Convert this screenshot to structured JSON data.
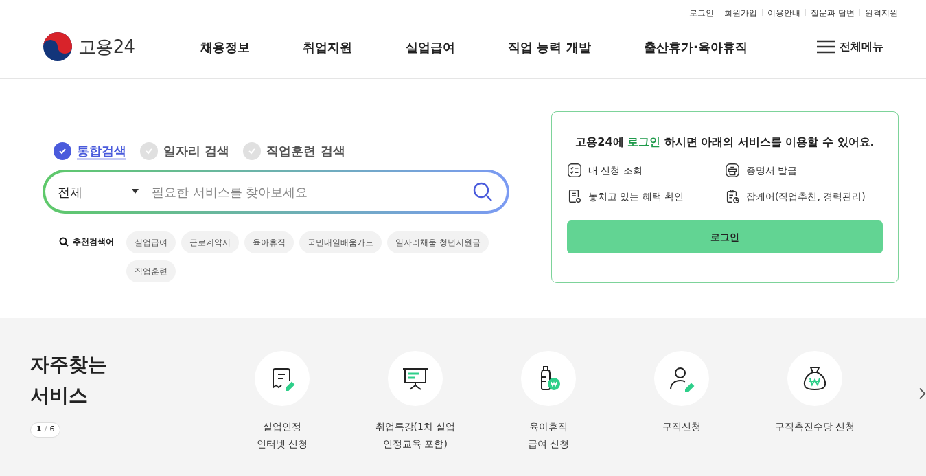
{
  "utility_links": [
    "로그인",
    "회원가입",
    "이용안내",
    "질문과 답변",
    "원격지원"
  ],
  "logo": {
    "text": "고용24"
  },
  "nav": [
    "채용정보",
    "취업지원",
    "실업급여",
    "직업 능력 개발",
    "출산휴가·육아휴직"
  ],
  "all_menu": "전체메뉴",
  "search": {
    "tabs": [
      {
        "label": "통합검색",
        "selected": true
      },
      {
        "label": "일자리 검색",
        "selected": false
      },
      {
        "label": "직업훈련 검색",
        "selected": false
      }
    ],
    "category": "전체",
    "placeholder": "필요한 서비스를 찾아보세요",
    "recommended_label": "추천검색어",
    "keywords": [
      "실업급여",
      "근로계약서",
      "육아휴직",
      "국민내일배움카드",
      "일자리채움 청년지원금",
      "직업훈련"
    ]
  },
  "login_panel": {
    "message_before": "고용24에 ",
    "message_highlight": "로그인",
    "message_after": " 하시면 아래의 서비스를 이용할 수 있어요.",
    "services": [
      {
        "label": "내 신청 조회",
        "kind": "checklist"
      },
      {
        "label": "증명서 발급",
        "kind": "printer"
      },
      {
        "label": "놓치고 있는 혜택 확인",
        "kind": "document"
      },
      {
        "label": "잡케어(직업추천, 경력관리)",
        "kind": "clipboard"
      }
    ],
    "button": "로그인"
  },
  "frequent": {
    "title": "자주찾는 서비스",
    "pager": {
      "current": "1",
      "separator": "/",
      "total": "6"
    },
    "items": [
      {
        "lines": [
          "실업인정",
          "인터넷 신청"
        ],
        "kind": "receipt"
      },
      {
        "lines": [
          "취업특강(1차 실업",
          "인정교육 포함)"
        ],
        "kind": "board"
      },
      {
        "lines": [
          "육아휴직",
          "급여 신청"
        ],
        "kind": "bottle"
      },
      {
        "lines": [
          "구직신청"
        ],
        "kind": "person"
      },
      {
        "lines": [
          "구직촉진수당 신청"
        ],
        "kind": "moneybag"
      }
    ]
  }
}
